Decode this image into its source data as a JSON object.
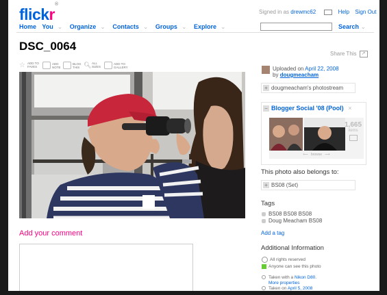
{
  "header": {
    "logo_main": "flick",
    "logo_r": "r",
    "logo_tm": "®",
    "signed_in_prefix": "Signed in as",
    "username": "drewmc62",
    "help": "Help",
    "sign_out": "Sign Out",
    "search_label": "Search",
    "search_value": ""
  },
  "nav": [
    {
      "label": "Home"
    },
    {
      "label": "You"
    },
    {
      "label": "Organize"
    },
    {
      "label": "Contacts"
    },
    {
      "label": "Groups"
    },
    {
      "label": "Explore"
    }
  ],
  "photo": {
    "title": "DSC_0064",
    "share_this": "Share This"
  },
  "toolbar": [
    {
      "label": "ADD TO FAVES",
      "icon": "star-icon"
    },
    {
      "label": "ADD NOTE",
      "icon": "note-icon"
    },
    {
      "label": "BLOG THIS",
      "icon": "blog-icon"
    },
    {
      "label": "ALL SIZES",
      "icon": "magnifier-icon"
    },
    {
      "label": "ADD TO GALLERY",
      "icon": "gallery-icon"
    }
  ],
  "comment": {
    "heading": "Add your comment"
  },
  "sidebar": {
    "uploaded_prefix": "Uploaded on",
    "uploaded_date": "April 22, 2008",
    "by_prefix": "by",
    "owner": "dougmeacham",
    "photostream": "dougmeacham's photostream",
    "pool_name": "Blogger Social '08 (Pool)",
    "pool_count": "1,665",
    "pool_count_unit": "items",
    "browse": "browse",
    "belongs_heading": "This photo also belongs to:",
    "set_name": "BS08 (Set)",
    "tags_heading": "Tags",
    "tags": [
      "BS08 BS08 BS08",
      "Doug Meacham BS08"
    ],
    "add_tag": "Add a tag",
    "additional_heading": "Additional Information",
    "rights": "All rights reserved",
    "visibility": "Anyone can see this photo",
    "taken_with_prefix": "Taken with a",
    "camera": "Nikon D80.",
    "more_properties": "More properties",
    "taken_on_prefix": "Taken on",
    "taken_on_date": "April 5, 2008"
  },
  "colors": {
    "flickr_blue": "#0063dc",
    "flickr_pink": "#ff0084"
  }
}
